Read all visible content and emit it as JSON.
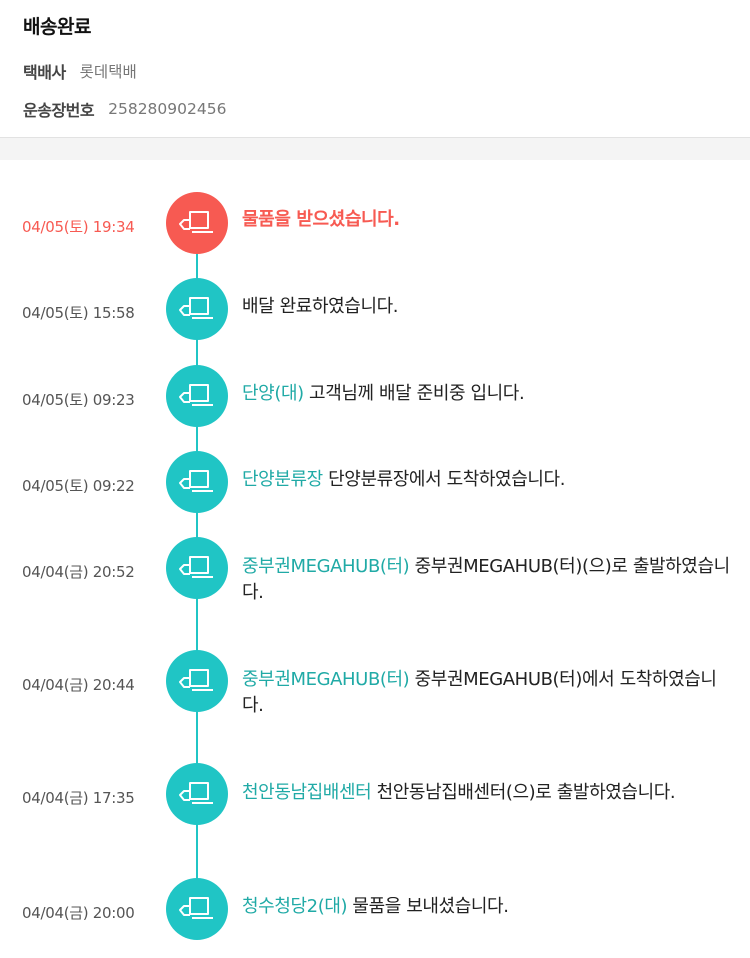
{
  "header": {
    "status_title": "배송완료",
    "courier_label": "택배사",
    "courier_value": "롯데택배",
    "tracking_label": "운송장번호",
    "tracking_value": "258280902456"
  },
  "colors": {
    "accent": "#20c5c5",
    "highlight": "#f75a52",
    "location_text": "#20aaa6"
  },
  "timeline": {
    "icon": "delivery-truck-icon",
    "events": [
      {
        "time": "04/05(토) 19:34",
        "location": "",
        "message": "물품을 받으셨습니다.",
        "highlight": true
      },
      {
        "time": "04/05(토) 15:58",
        "location": "",
        "message": "배달 완료하였습니다.",
        "highlight": false
      },
      {
        "time": "04/05(토) 09:23",
        "location": "단양(대)",
        "message": " 고객님께 배달 준비중 입니다.",
        "highlight": false
      },
      {
        "time": "04/05(토) 09:22",
        "location": "단양분류장",
        "message": " 단양분류장에서 도착하였습니다.",
        "highlight": false
      },
      {
        "time": "04/04(금) 20:52",
        "location": "중부권MEGAHUB(터)",
        "message": " 중부권MEGAHUB(터)(으)로 출발하였습니다.",
        "highlight": false
      },
      {
        "time": "04/04(금) 20:44",
        "location": "중부권MEGAHUB(터)",
        "message": " 중부권MEGAHUB(터)에서 도착하였습니다.",
        "highlight": false
      },
      {
        "time": "04/04(금) 17:35",
        "location": "천안동남집배센터",
        "message": " 천안동남집배센터(으)로 출발하였습니다.",
        "highlight": false
      },
      {
        "time": "04/04(금) 20:00",
        "location": "청수청당2(대)",
        "message": " 물품을 보내셨습니다.",
        "highlight": false
      }
    ]
  }
}
